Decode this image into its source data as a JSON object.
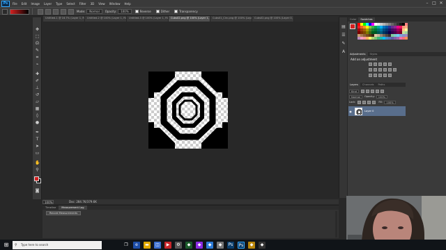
{
  "menu": {
    "logo": "Ps",
    "items": [
      "File",
      "Edit",
      "Image",
      "Layer",
      "Type",
      "Select",
      "Filter",
      "3D",
      "View",
      "Window",
      "Help"
    ]
  },
  "window_controls": [
    "minimize",
    "maximize",
    "close"
  ],
  "options": {
    "mode_label": "Mode:",
    "mode_value": "Normal",
    "opacity_label": "Opacity:",
    "opacity_value": "100%",
    "reverse_label": "Reverse",
    "dither_label": "Dither",
    "transparency_label": "Transparency"
  },
  "tabs": [
    {
      "label": "Untitled-1 @ 16.7% (Layer 1, RGB/8...",
      "active": false
    },
    {
      "label": "Untitled-2 @ 100% (Layer 1, RGB...",
      "active": false
    },
    {
      "label": "Untitled-3 @ 100% (Layer 1, RGB...",
      "active": false
    },
    {
      "label": "Cubs02.png @ 100% (Layer 1, RGB...",
      "active": true
    },
    {
      "label": "Cubs01_Circ.png @ 100% (Layer 1, RGB/8...",
      "active": false
    },
    {
      "label": "Cubs02.png @ 100% (Layer 0, RGB/8...",
      "active": false
    }
  ],
  "status": {
    "zoom": "100%",
    "doc": "Doc: 284.7K/379.6K"
  },
  "bottom_panel": {
    "tabs": [
      "Timeline",
      "Measurement Log"
    ],
    "active_tab": "Measurement Log",
    "record_button": "Record Measurements"
  },
  "right_panel": {
    "color_tabs": [
      "Color",
      "Swatches"
    ],
    "active_color_tab": "Swatches",
    "adjust_tabs": [
      "Adjustments",
      "Styles"
    ],
    "adjust_title": "Add an adjustment",
    "layers_tabs": [
      "Layers",
      "Channels",
      "Paths"
    ],
    "kind_label": "Kind",
    "blend_mode": "Normal",
    "opacity_label": "Opacity:",
    "opacity_value": "100%",
    "lock_label": "Lock:",
    "fill_label": "Fill:",
    "fill_value": "100%",
    "layer_name": "Layer 0"
  },
  "taskbar": {
    "search_placeholder": "Type here to search"
  },
  "colors": {
    "foreground": "#d42020",
    "background": "#000000",
    "selected_layer": "#596e8c",
    "swatches": [
      "#ff0000",
      "#ffff00",
      "#00ff00",
      "#00ffff",
      "#0000ff",
      "#ff00ff",
      "#ffffff",
      "#e6e6e6",
      "#cccccc",
      "#b3b3b3",
      "#999999",
      "#808080",
      "#666666",
      "#4d4d4d",
      "#333333",
      "#1a1a1a",
      "#000000",
      "#ff8080",
      "#ed1c24",
      "#f26522",
      "#f7941d",
      "#fff200",
      "#8dc63f",
      "#39b54a",
      "#00a651",
      "#00a99d",
      "#00aeef",
      "#0072bc",
      "#0054a6",
      "#2e3192",
      "#662d91",
      "#92278f",
      "#ec008c",
      "#ed145b",
      "#f69679",
      "#f9ad81",
      "#9e0b0f",
      "#a0410d",
      "#a36209",
      "#aba000",
      "#598527",
      "#1a7b30",
      "#007236",
      "#00746b",
      "#0076a3",
      "#004b80",
      "#003471",
      "#1b1464",
      "#440e62",
      "#630460",
      "#9e005d",
      "#9e0039",
      "#fdc689",
      "#fff799",
      "#790000",
      "#7b2e00",
      "#7d4900",
      "#827b00",
      "#406618",
      "#005e20",
      "#005826",
      "#005952",
      "#005b7f",
      "#003663",
      "#002157",
      "#0d004c",
      "#32004b",
      "#4b0049",
      "#7b0046",
      "#7a0026",
      "#c4df9b",
      "#a2d39c",
      "#c69c6d",
      "#a67c52",
      "#8c6239",
      "#754c24",
      "#603913",
      "#3c2415",
      "#e2caa4",
      "#c7b299",
      "#998675",
      "#736357",
      "#534741",
      "#362f2d",
      "#82ca9c",
      "#7accc8",
      "#6dcff6",
      "#7da7d9",
      "#8393ca",
      "#a187be",
      "#bd8cbf",
      "#f49ac2",
      "#f6989d",
      "#fbaf5d",
      "#fff568",
      "#acd372",
      "#7cc576",
      "#3bb878",
      "#1abbb4",
      "#00bff3",
      "#438ccb",
      "#5574b9",
      "#605ca8",
      "#855fa8",
      "#a763a8",
      "#f06ea9",
      "#f26d7d",
      "#f68e56"
    ]
  }
}
